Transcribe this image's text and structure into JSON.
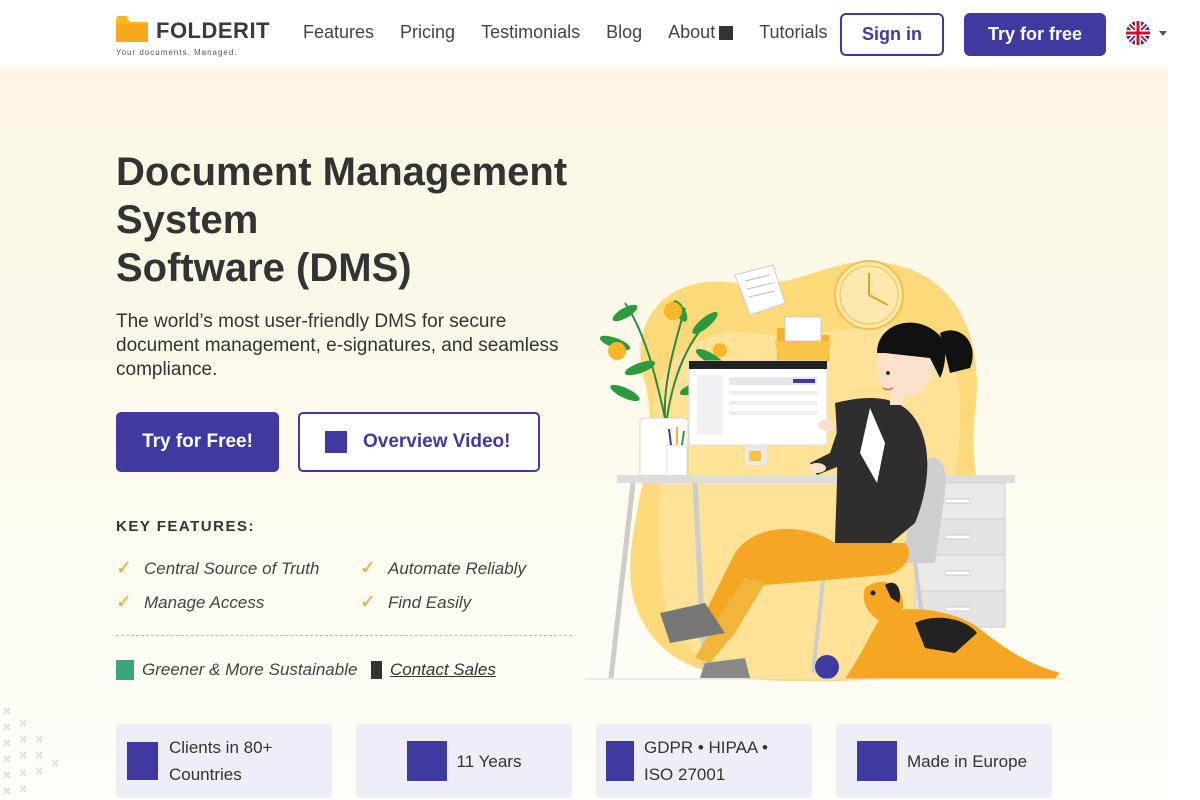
{
  "brand": {
    "name": "FOLDERIT",
    "tagline": "Your documents. Managed.",
    "color_accent": "#3f3aa0",
    "color_logo": "#f9b628"
  },
  "nav": {
    "links": [
      "Features",
      "Pricing",
      "Testimonials",
      "Blog",
      "About",
      "Tutorials"
    ],
    "sign_in": "Sign in",
    "try_free": "Try for free",
    "language_icon": "uk-flag-icon"
  },
  "hero": {
    "headline_lines": [
      "Document Management",
      "System",
      "Software (DMS)"
    ],
    "subtitle": "The world’s most user-friendly DMS for secure document management, e-signatures, and seamless compliance.",
    "cta_primary": "Try for Free!",
    "cta_secondary": "Overview Video!",
    "key_features_title": "KEY FEATURES:",
    "features": [
      "Central Source of Truth",
      "Automate Reliably",
      "Manage Access",
      "Find Easily"
    ],
    "green_label": "Greener & More Sustainable",
    "contact_label": "Contact Sales"
  },
  "stats": [
    {
      "text": "Clients in 80+ Countries"
    },
    {
      "text": "11 Years"
    },
    {
      "text": "GDPR • HIPAA • ISO 27001"
    },
    {
      "text": "Made in Europe"
    }
  ]
}
